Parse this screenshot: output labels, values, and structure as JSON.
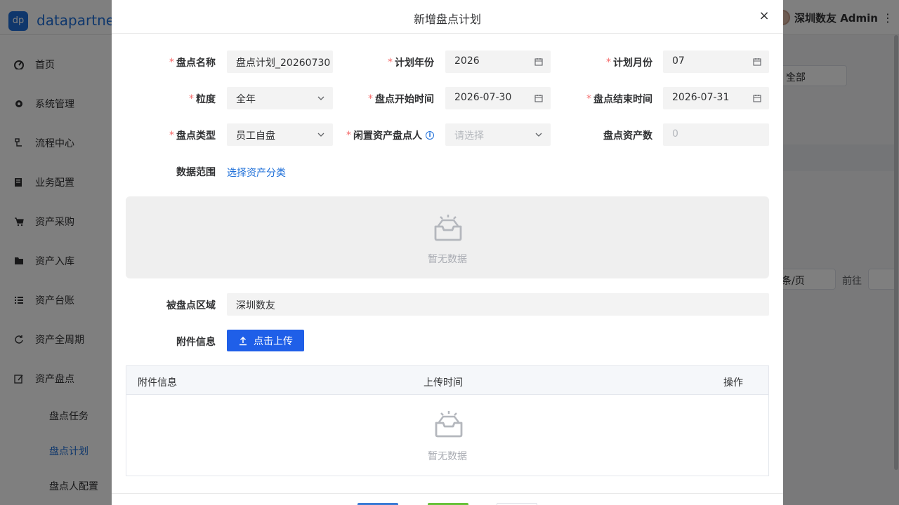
{
  "app": {
    "logo_text": "dp",
    "brand": "datapartner.",
    "user_name": "深圳数友 Admin"
  },
  "sidebar": {
    "items": [
      {
        "label": "首页",
        "icon": "dashboard-icon"
      },
      {
        "label": "系统管理",
        "icon": "gear-icon"
      },
      {
        "label": "流程中心",
        "icon": "flow-icon"
      },
      {
        "label": "业务配置",
        "icon": "config-icon"
      },
      {
        "label": "资产采购",
        "icon": "cart-icon"
      },
      {
        "label": "资产入库",
        "icon": "folder-icon"
      },
      {
        "label": "资产台账",
        "icon": "list-icon"
      },
      {
        "label": "资产全周期",
        "icon": "cycle-icon"
      },
      {
        "label": "资产盘点",
        "icon": "edit-icon"
      }
    ],
    "sub_items": [
      {
        "label": "盘点任务",
        "active": false
      },
      {
        "label": "盘点计划",
        "active": true
      },
      {
        "label": "盘点人配置",
        "active": false
      }
    ]
  },
  "background": {
    "filter_value": "全部",
    "page_size_text": "条/页",
    "goto_label": "前往"
  },
  "dialog": {
    "title": "新增盘点计划",
    "close": "×",
    "fields": {
      "plan_name": {
        "label": "盘点名称",
        "required": true,
        "value": "盘点计划_20260730"
      },
      "plan_year": {
        "label": "计划年份",
        "required": true,
        "value": "2026"
      },
      "plan_month": {
        "label": "计划月份",
        "required": true,
        "value": "07"
      },
      "granularity": {
        "label": "粒度",
        "required": true,
        "value": "全年"
      },
      "start_time": {
        "label": "盘点开始时间",
        "required": true,
        "value": "2026-07-30"
      },
      "end_time": {
        "label": "盘点结束时间",
        "required": true,
        "value": "2026-07-31"
      },
      "plan_type": {
        "label": "盘点类型",
        "required": true,
        "value": "员工自盘"
      },
      "idle_checker": {
        "label": "闲置资产盘点人",
        "required": true,
        "placeholder": "请选择"
      },
      "asset_count": {
        "label": "盘点资产数",
        "required": false,
        "placeholder": "0"
      },
      "data_scope": {
        "label": "数据范围",
        "link": "选择资产分类"
      },
      "region": {
        "label": "被盘点区域",
        "value": "深圳数友"
      },
      "attachment": {
        "label": "附件信息",
        "button": "点击上传"
      }
    },
    "empty_text": "暂无数据",
    "table": {
      "columns": [
        "附件信息",
        "上传时间",
        "操作"
      ],
      "empty_text": "暂无数据"
    }
  },
  "colors": {
    "primary": "#1e6fd9",
    "upload_button": "#1f5fe8",
    "required": "#f56c6c",
    "field_bg": "#f3f3f3",
    "footer_buttons": [
      "#3a7bd5",
      "#67c23a",
      "#ffffff"
    ]
  }
}
